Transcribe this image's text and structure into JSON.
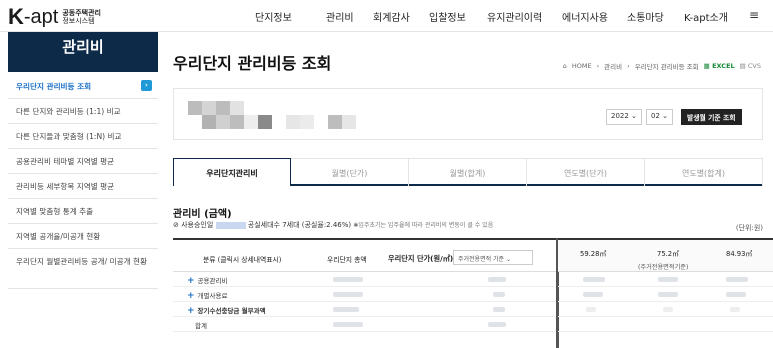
{
  "header": {
    "logo_main": "K",
    "logo_apt": "-apt",
    "logo_sub1": "공동주택관리",
    "logo_sub2": "정보시스템",
    "nav": [
      "단지정보",
      "관리비",
      "회계감사",
      "입찰정보",
      "유지관리이력",
      "에너지사용",
      "소통마당",
      "K-apt소개"
    ],
    "menu_icon": "≡"
  },
  "sidebar": {
    "title": "관리비",
    "items": [
      {
        "label": "우리단지 관리비등 조회",
        "active": true
      },
      {
        "label": "다른 단지와 관리비등 (1:1) 비교"
      },
      {
        "label": "다른 단지들과 맞춤형 (1:N) 비교"
      },
      {
        "label": "공용관리비 테마별 지역별 평균"
      },
      {
        "label": "관리비등 세부항목 지역별 평균"
      },
      {
        "label": "지역별 맞춤형 통계 추출"
      },
      {
        "label": "지역별 공개율/미공개 현황"
      },
      {
        "label": "우리단지 월별관리비등 공개/ 미공개 현황"
      }
    ],
    "arrow": "›"
  },
  "main": {
    "title": "우리단지 관리비등 조회",
    "breadcrumb": {
      "home": "HOME",
      "sep": "›",
      "level1": "관리비",
      "level2": "우리단지 관리비등 조회"
    },
    "excel_label": "EXCEL",
    "cvs_label": "CVS",
    "year_select": "2022",
    "month_select": "02",
    "issue_button": "발생월 기준 조회",
    "tabs": [
      "우리단지관리비",
      "월별(단가)",
      "월별(합계)",
      "연도별(단가)",
      "연도별(합계)"
    ],
    "section_title": "관리비 (금액)",
    "usage_prefix": "사용승인일",
    "usage_mid": "공실세대수 7세대 (공실율:2.46%)",
    "usage_note": "입주초기는 입주율에 따라 관리비의 변동이 클 수 있음",
    "unit": "(단위:원)",
    "table": {
      "col_category": "분류 (클릭시 상세내역표시)",
      "col_total": "우리단지 총액",
      "col_unit": "우리단지 단가(원/㎡)",
      "col_unit_select": "주거전용면적 기준",
      "rows": [
        {
          "label": "공용관리비",
          "plus": "+"
        },
        {
          "label": "개별사용료",
          "plus": "+"
        },
        {
          "label": "장기수선충당금 월부과액",
          "plus": "+"
        },
        {
          "label": "합계",
          "plus": ""
        }
      ]
    },
    "right_table": {
      "col1": "59.28㎡",
      "col2": "75.2㎡",
      "col2_sub": "(주거전용면적기준)",
      "col3": "84.93㎡"
    }
  },
  "colors": {
    "navy": "#0e2a49",
    "accent": "#1a6fc7",
    "excel": "#1a8a3a"
  }
}
